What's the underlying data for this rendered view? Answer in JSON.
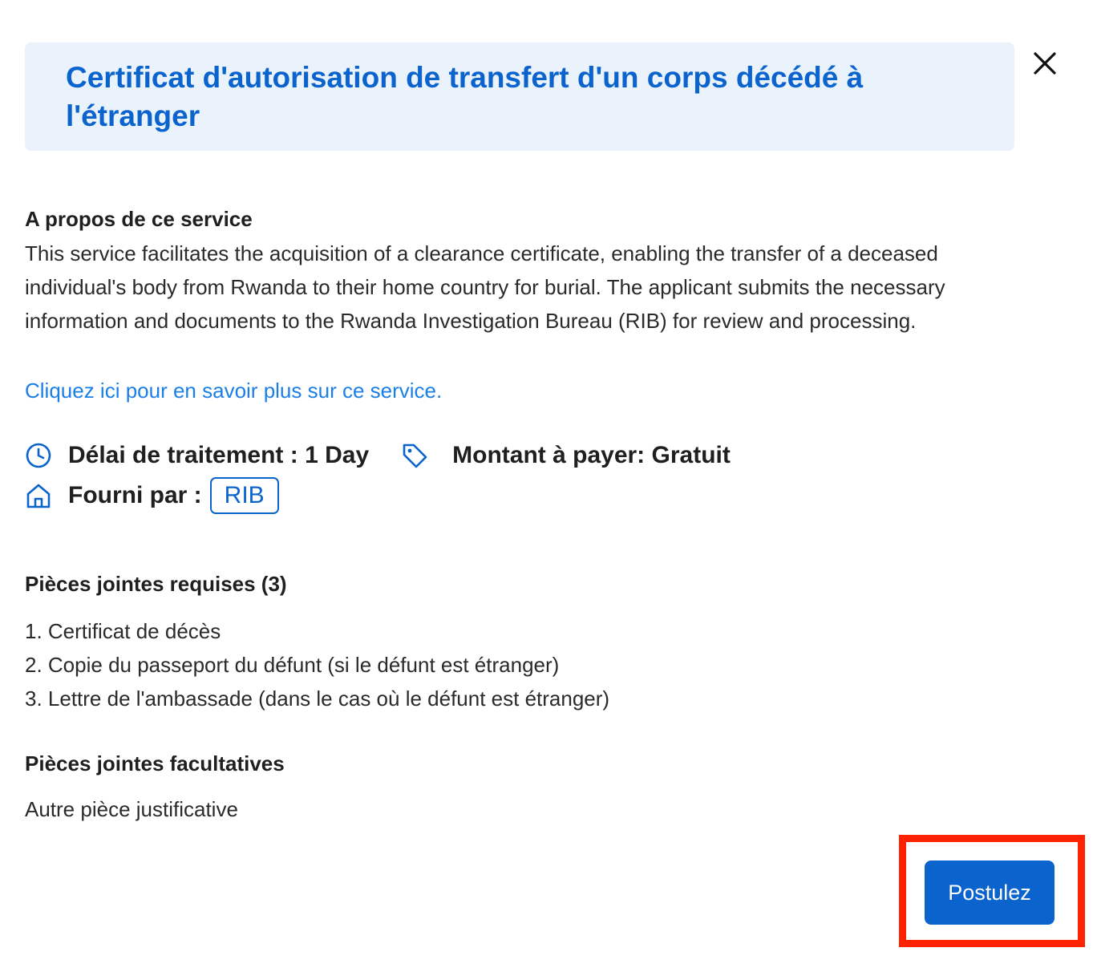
{
  "dialog": {
    "title": "Certificat d'autorisation de transfert d'un corps décédé à l'étranger",
    "close_icon": "close-icon"
  },
  "about": {
    "heading": "A propos de ce service",
    "description": "This service facilitates the acquisition of a clearance certificate, enabling the transfer of a deceased individual's body from Rwanda to their home country for burial. The applicant submits the necessary information and documents to the Rwanda Investigation Bureau (RIB) for review and processing.",
    "learn_more_link": "Cliquez ici pour en savoir plus sur ce service."
  },
  "meta": {
    "processing_time": {
      "icon": "clock-icon",
      "text": "Délai de traitement : 1 Day"
    },
    "amount": {
      "icon": "tag-icon",
      "text": "Montant à payer: Gratuit"
    },
    "provider": {
      "icon": "home-icon",
      "label": "Fourni par :",
      "badge": "RIB"
    }
  },
  "required_attachments": {
    "heading": "Pièces jointes requises (3)",
    "items": [
      "1. Certificat de décès",
      "2. Copie du passeport du défunt (si le défunt est étranger)",
      "3. Lettre de l'ambassade (dans le cas où le défunt est étranger)"
    ]
  },
  "optional_attachments": {
    "heading": "Pièces jointes facultatives",
    "text": "Autre pièce justificative"
  },
  "actions": {
    "apply_label": "Postulez"
  },
  "colors": {
    "accent": "#0b63ce",
    "link": "#1a7fe6",
    "banner_bg": "#eaf2fc",
    "highlight": "#ff2200"
  }
}
